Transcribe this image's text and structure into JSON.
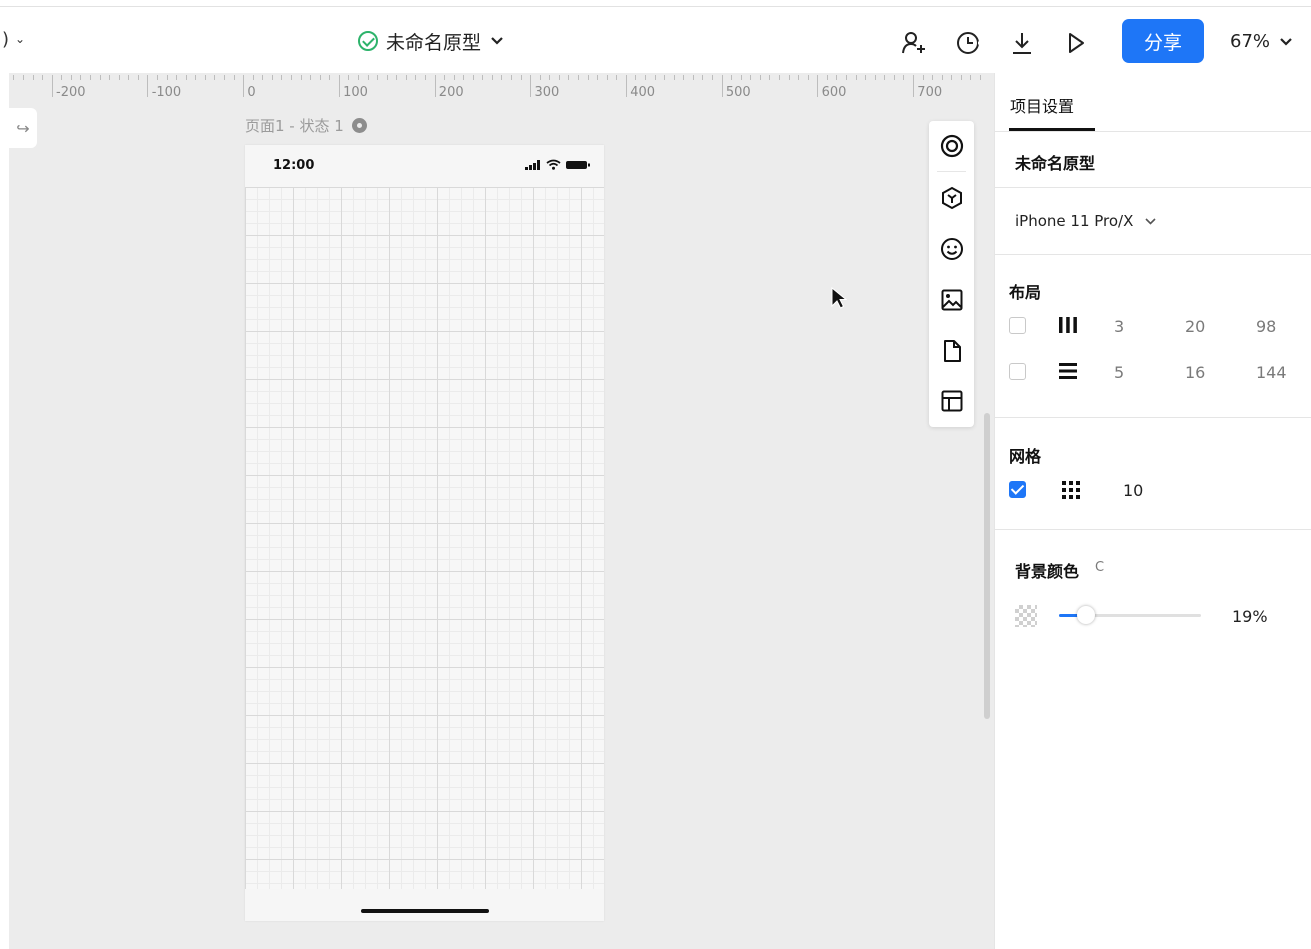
{
  "topbar": {
    "left_fragment": ")",
    "project_title": "未命名原型",
    "share_label": "分享",
    "zoom_label": "67%",
    "icons": [
      "add-user-icon",
      "history-icon",
      "download-icon",
      "play-icon"
    ]
  },
  "ruler": {
    "labels": [
      "-200",
      "-100",
      "0",
      "100",
      "200",
      "300",
      "400",
      "500",
      "600",
      "700"
    ]
  },
  "canvas": {
    "page_label": "页面1 - 状态 1",
    "status_time": "12:00",
    "toolbar_icons": [
      "target-icon",
      "component-icon",
      "emoji-icon",
      "image-icon",
      "page-icon",
      "layout-icon"
    ]
  },
  "panel": {
    "tab_label": "项目设置",
    "project_name": "未命名原型",
    "device": "iPhone 11 Pro/X",
    "layout": {
      "heading": "布局",
      "rows": [
        {
          "checked": false,
          "icon": "columns-icon",
          "count": "3",
          "gutter": "20",
          "width": "98"
        },
        {
          "checked": false,
          "icon": "rows-icon",
          "count": "5",
          "gutter": "16",
          "width": "144"
        }
      ]
    },
    "grid": {
      "heading": "网格",
      "checked": true,
      "icon": "dot-grid-icon",
      "size": "10"
    },
    "background": {
      "heading": "背景颜色",
      "suffix": "C",
      "opacity_label": "19%",
      "opacity": 0.19
    }
  },
  "colors": {
    "accent": "#1e76f7",
    "success": "#2db36b",
    "canvas": "#ececec"
  }
}
